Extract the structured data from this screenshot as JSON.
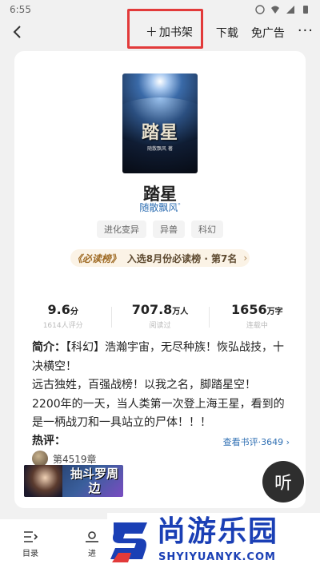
{
  "status_bar": {
    "time": "6:55"
  },
  "topbar": {
    "add_shelf_label": "加书架",
    "download_label": "下载",
    "no_ads_label": "免广告",
    "more_label": "···"
  },
  "book": {
    "cover_title": "踏星",
    "cover_author": "随散飘风 著",
    "title": "踏星",
    "author": "随散飘风",
    "tags": [
      "进化变异",
      "异兽",
      "科幻"
    ],
    "rank_badge": "必读榜",
    "rank_text": "入选8月份必读榜 · 第7名"
  },
  "stats": [
    {
      "value": "9.6",
      "unit": "分",
      "label": "1614人评分"
    },
    {
      "value": "707.8",
      "unit": "万人",
      "label": "阅读过"
    },
    {
      "value": "1656",
      "unit": "万字",
      "label": "连载中"
    }
  ],
  "synopsis": {
    "heading": "简介：",
    "line1": "【科幻】浩瀚宇宙，无尽种族！恢弘战技，十决横空！",
    "line2": "远古独姓，百强战榜！以我之名，脚踏星空！",
    "line3": "2200年的一天，当人类第一次登上海王星，看到的是一柄战刀和一具站立的尸体！！！"
  },
  "comments": {
    "title": "热评：",
    "link": "查看书评·3649",
    "first_chapter": "第4519章"
  },
  "promo": {
    "text": "抽斗罗周边"
  },
  "listen_label": "听",
  "bottom_nav": [
    {
      "label": "目录"
    },
    {
      "label": "进"
    }
  ],
  "watermark": {
    "cn": "尚游乐园",
    "en": "SHYIYUANYK.COM"
  },
  "colors": {
    "accent_blue": "#2f6fb3",
    "highlight_red": "#e23a3a",
    "watermark_blue": "#1a3fb5"
  }
}
